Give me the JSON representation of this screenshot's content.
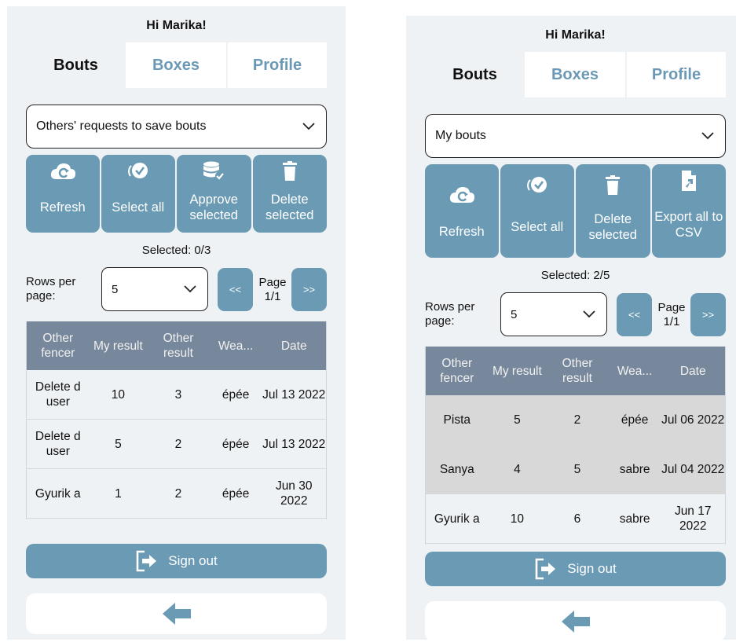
{
  "colors": {
    "accent": "#6a9ab4",
    "header": "#78889c",
    "selected_row": "#d8d8d8",
    "bg": "#eef2f5"
  },
  "screen1": {
    "greeting": "Hi Marika!",
    "tabs": [
      "Bouts",
      "Boxes",
      "Profile"
    ],
    "dropdown": "Others' requests to save bouts",
    "actions": [
      {
        "icon": "cloud-refresh-icon",
        "label": "Refresh"
      },
      {
        "icon": "check-circle-icon",
        "label": "Select all"
      },
      {
        "icon": "database-check-icon",
        "label": "Approve selected"
      },
      {
        "icon": "trash-icon",
        "label": "Delete selected"
      }
    ],
    "selected": "Selected: 0/3",
    "rows_per_page_label": "Rows per page:",
    "rows_per_page": "5",
    "prev": "<<",
    "next": ">>",
    "page": "Page 1/1",
    "columns": [
      "Other fencer",
      "My result",
      "Other result",
      "Wea...",
      "Date"
    ],
    "rows": [
      [
        "Delete d user",
        "10",
        "3",
        "épée",
        "Jul 13 2022"
      ],
      [
        "Delete d user",
        "5",
        "2",
        "épée",
        "Jul 13 2022"
      ],
      [
        "Gyurik a",
        "1",
        "2",
        "épée",
        "Jun 30 2022"
      ]
    ],
    "sign_out": "Sign out"
  },
  "screen2": {
    "greeting": "Hi Marika!",
    "tabs": [
      "Bouts",
      "Boxes",
      "Profile"
    ],
    "dropdown": "My bouts",
    "actions": [
      {
        "icon": "cloud-refresh-icon",
        "label": "Refresh"
      },
      {
        "icon": "check-circle-icon",
        "label": "Select all"
      },
      {
        "icon": "trash-icon",
        "label": "Delete selected"
      },
      {
        "icon": "file-export-icon",
        "label": "Export all to CSV"
      }
    ],
    "selected": "Selected: 2/5",
    "rows_per_page_label": "Rows per page:",
    "rows_per_page": "5",
    "prev": "<<",
    "next": ">>",
    "page": "Page 1/1",
    "columns": [
      "Other fencer",
      "My result",
      "Other result",
      "Wea...",
      "Date"
    ],
    "rows": [
      [
        "Pista",
        "5",
        "2",
        "épée",
        "Jul 06 2022"
      ],
      [
        "Sanya",
        "4",
        "5",
        "sabre",
        "Jul 04 2022"
      ],
      [
        "Gyurik a",
        "10",
        "6",
        "sabre",
        "Jun 17 2022"
      ]
    ],
    "sign_out": "Sign out"
  }
}
